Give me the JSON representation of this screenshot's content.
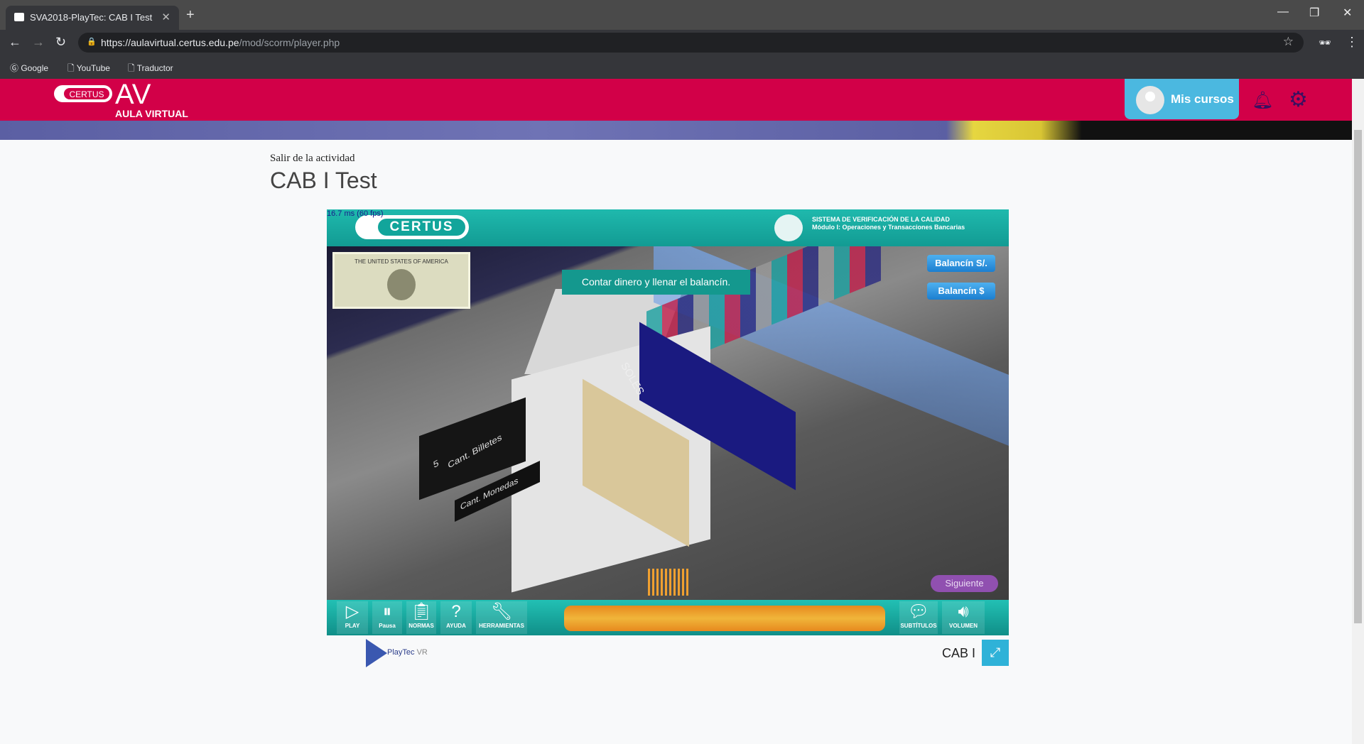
{
  "browser": {
    "tab_title": "SVA2018-PlayTec: CAB I Test",
    "url_host": "https://aulavirtual.certus.edu.pe",
    "url_path": "/mod/scorm/player.php",
    "bookmarks": [
      "Google",
      "YouTube",
      "Traductor"
    ]
  },
  "header": {
    "logo_pill": "CERTUS",
    "logo_av": "AV",
    "logo_sub": "AULA VIRTUAL",
    "mis_cursos": "Mis cursos",
    "accent": "#d20048"
  },
  "page": {
    "exit_link": "Salir de la actividad",
    "title": "CAB I Test"
  },
  "game": {
    "fps": "16.7 ms (60 fps)",
    "logo": "CERTUS",
    "system_title": "SISTEMA DE VERIFICACIÓN DE LA CALIDAD",
    "system_sub": "Módulo I: Operaciones y Transacciones Bancarias",
    "bill_text": "THE UNITED STATES OF AMERICA",
    "instruction": "Contar dinero y llenar el balancín.",
    "balancin_soles": "Balancín S/.",
    "balancin_dolares": "Balancín $",
    "scene_labels": [
      "Cant. Billetes",
      "Cant. Monedas",
      "SOLES"
    ],
    "billetes_count": "5",
    "siguiente": "Siguiente",
    "toolbar": [
      "PLAY",
      "Pausa",
      "NORMAS",
      "AYUDA",
      "HERRAMIENTAS",
      "SUBTÍTULOS",
      "VOLUMEN"
    ]
  },
  "footer": {
    "brand": "PlayTec",
    "brand_suffix": "VR",
    "module_label": "CAB I"
  }
}
